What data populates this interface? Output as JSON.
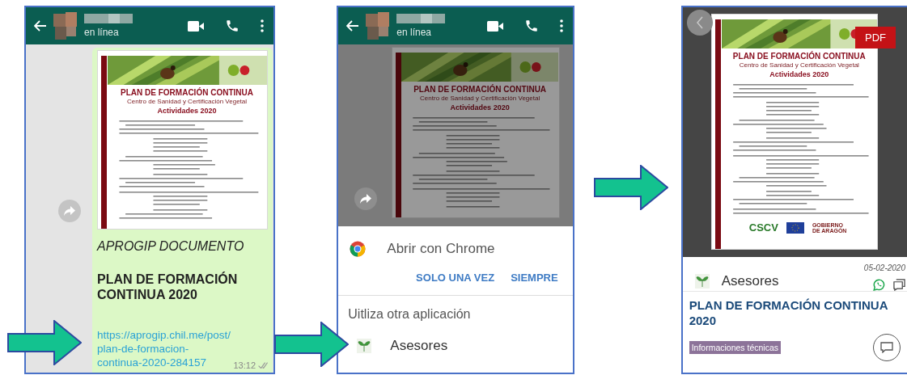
{
  "chat_screen": {
    "header": {
      "status": "en línea"
    },
    "document": {
      "title": "PLAN DE FORMACIÓN CONTINUA",
      "subtitle": "Centro de Sanidad y Certificación Vegetal",
      "heading": "Actividades 2020"
    },
    "caption": "APROGIP DOCUMENTO",
    "title": "PLAN DE FORMACIÓN CONTINUA 2020",
    "link": "https://aprogip.chil.me/post/plan-de-formacion-continua-2020-284157",
    "time": "13:12"
  },
  "chooser_screen": {
    "header": {
      "status": "en línea"
    },
    "document": {
      "title": "PLAN DE FORMACIÓN CONTINUA",
      "subtitle": "Centro de Sanidad y Certificación Vegetal",
      "heading": "Actividades 2020"
    },
    "chrome_option": "Abrir con Chrome",
    "buttons": [
      "SOLO UNA VEZ",
      "SIEMPRE"
    ],
    "other_label": "Uitliza otra aplicación",
    "apps": [
      {
        "name": "Asesores"
      }
    ]
  },
  "post_screen": {
    "document": {
      "title": "PLAN DE FORMACIÓN CONTINUA",
      "subtitle": "Centro de Sanidad y Certificación Vegetal",
      "heading": "Actividades 2020",
      "footer": [
        "CSCV",
        "GOBIERNO DE ARAGÓN"
      ]
    },
    "badge": "PDF",
    "author": "Asesores",
    "date": "05-02-2020",
    "title": "PLAN DE FORMACIÓN CONTINUA 2020",
    "tag": "Informaciones técnicas"
  }
}
